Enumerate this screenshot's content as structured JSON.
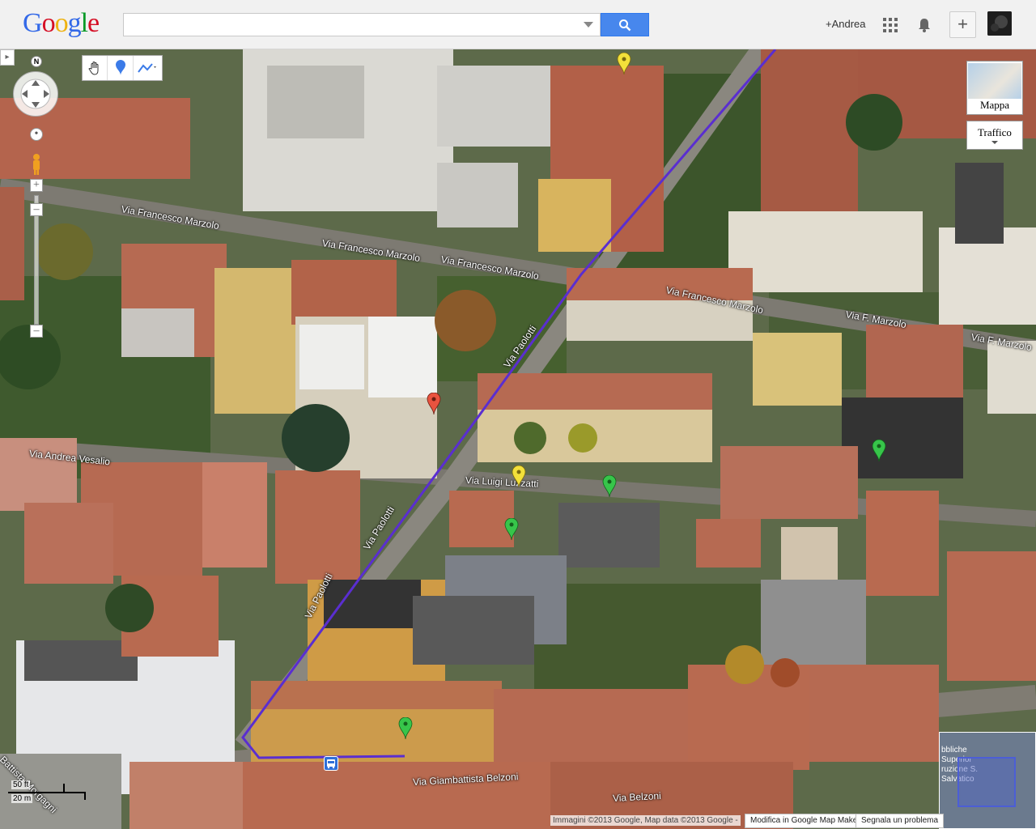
{
  "header": {
    "logo_letters": [
      "G",
      "o",
      "o",
      "g",
      "l",
      "e"
    ],
    "logo_colors": [
      "#3369e8",
      "#d50f25",
      "#eeb211",
      "#3369e8",
      "#009925",
      "#d50f25"
    ],
    "search_value": "",
    "search_placeholder": "",
    "user_name": "+Andrea",
    "plus_label": "+"
  },
  "map_controls": {
    "compass_label": "N",
    "map_type_label": "Mappa",
    "traffic_label": "Traffico",
    "scale_top": "50 ft",
    "scale_bottom": "20 m"
  },
  "streets": [
    {
      "name": "Via Francesco Marzolo"
    },
    {
      "name": "Via Francesco Marzolo"
    },
    {
      "name": "Via Francesco Marzolo"
    },
    {
      "name": "Via Francesco Marzolo"
    },
    {
      "name": "Via F. Marzolo"
    },
    {
      "name": "Via F. Marzolo"
    },
    {
      "name": "Via Paolotti"
    },
    {
      "name": "Via Paolotti"
    },
    {
      "name": "Via Paolotti"
    },
    {
      "name": "Via Andrea Vesalio"
    },
    {
      "name": "Via Luigi Luzzatti"
    },
    {
      "name": "Via Giambattista Belzoni"
    },
    {
      "name": "Via Belzoni"
    },
    {
      "name": "Battista Morgagni"
    }
  ],
  "pins": [
    {
      "color": "#f3e03a"
    },
    {
      "color": "#e9533f"
    },
    {
      "color": "#f3e03a"
    },
    {
      "color": "#37c54a"
    },
    {
      "color": "#37c54a"
    },
    {
      "color": "#37c54a"
    },
    {
      "color": "#37c54a"
    }
  ],
  "overview_text": "bbliche Superior ruzione S. Salvatico",
  "footer": {
    "copyright": "Immagini ©2013 Google, Map data ©2013 Google -",
    "edit_link": "Modifica in Google Map Maker",
    "report_link": "Segnala un problema"
  },
  "colors": {
    "route": "#5a2ed0",
    "search_button": "#4787ed"
  }
}
